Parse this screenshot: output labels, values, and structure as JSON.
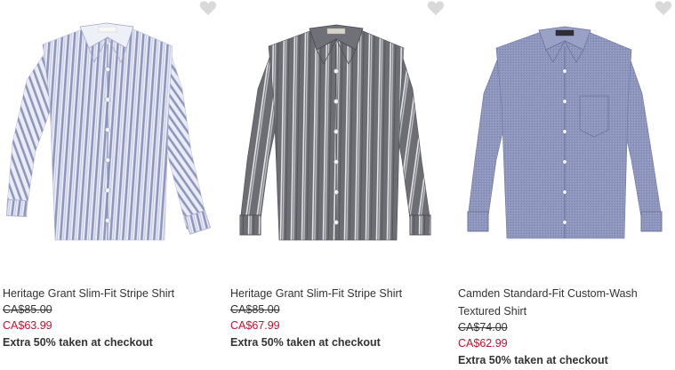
{
  "colors": {
    "sale": "#c8102e",
    "heart": "#d9d9d9"
  },
  "products": [
    {
      "name": "Heritage Grant Slim-Fit Stripe Shirt",
      "original_price": "CA$85.00",
      "sale_price": "CA$63.99",
      "promo": "Extra 50% taken at checkout",
      "wishlist_icon": "heart-icon",
      "image_desc": "light-blue-white-stripe-shirt"
    },
    {
      "name": "Heritage Grant Slim-Fit Stripe Shirt",
      "original_price": "CA$85.00",
      "sale_price": "CA$67.99",
      "promo": "Extra 50% taken at checkout",
      "wishlist_icon": "heart-icon",
      "image_desc": "grey-white-stripe-shirt"
    },
    {
      "name": "Camden Standard-Fit Custom-Wash Textured Shirt",
      "original_price": "CA$74.00",
      "sale_price": "CA$62.99",
      "promo": "Extra 50% taken at checkout",
      "wishlist_icon": "heart-icon",
      "image_desc": "blue-textured-pocket-shirt"
    }
  ]
}
